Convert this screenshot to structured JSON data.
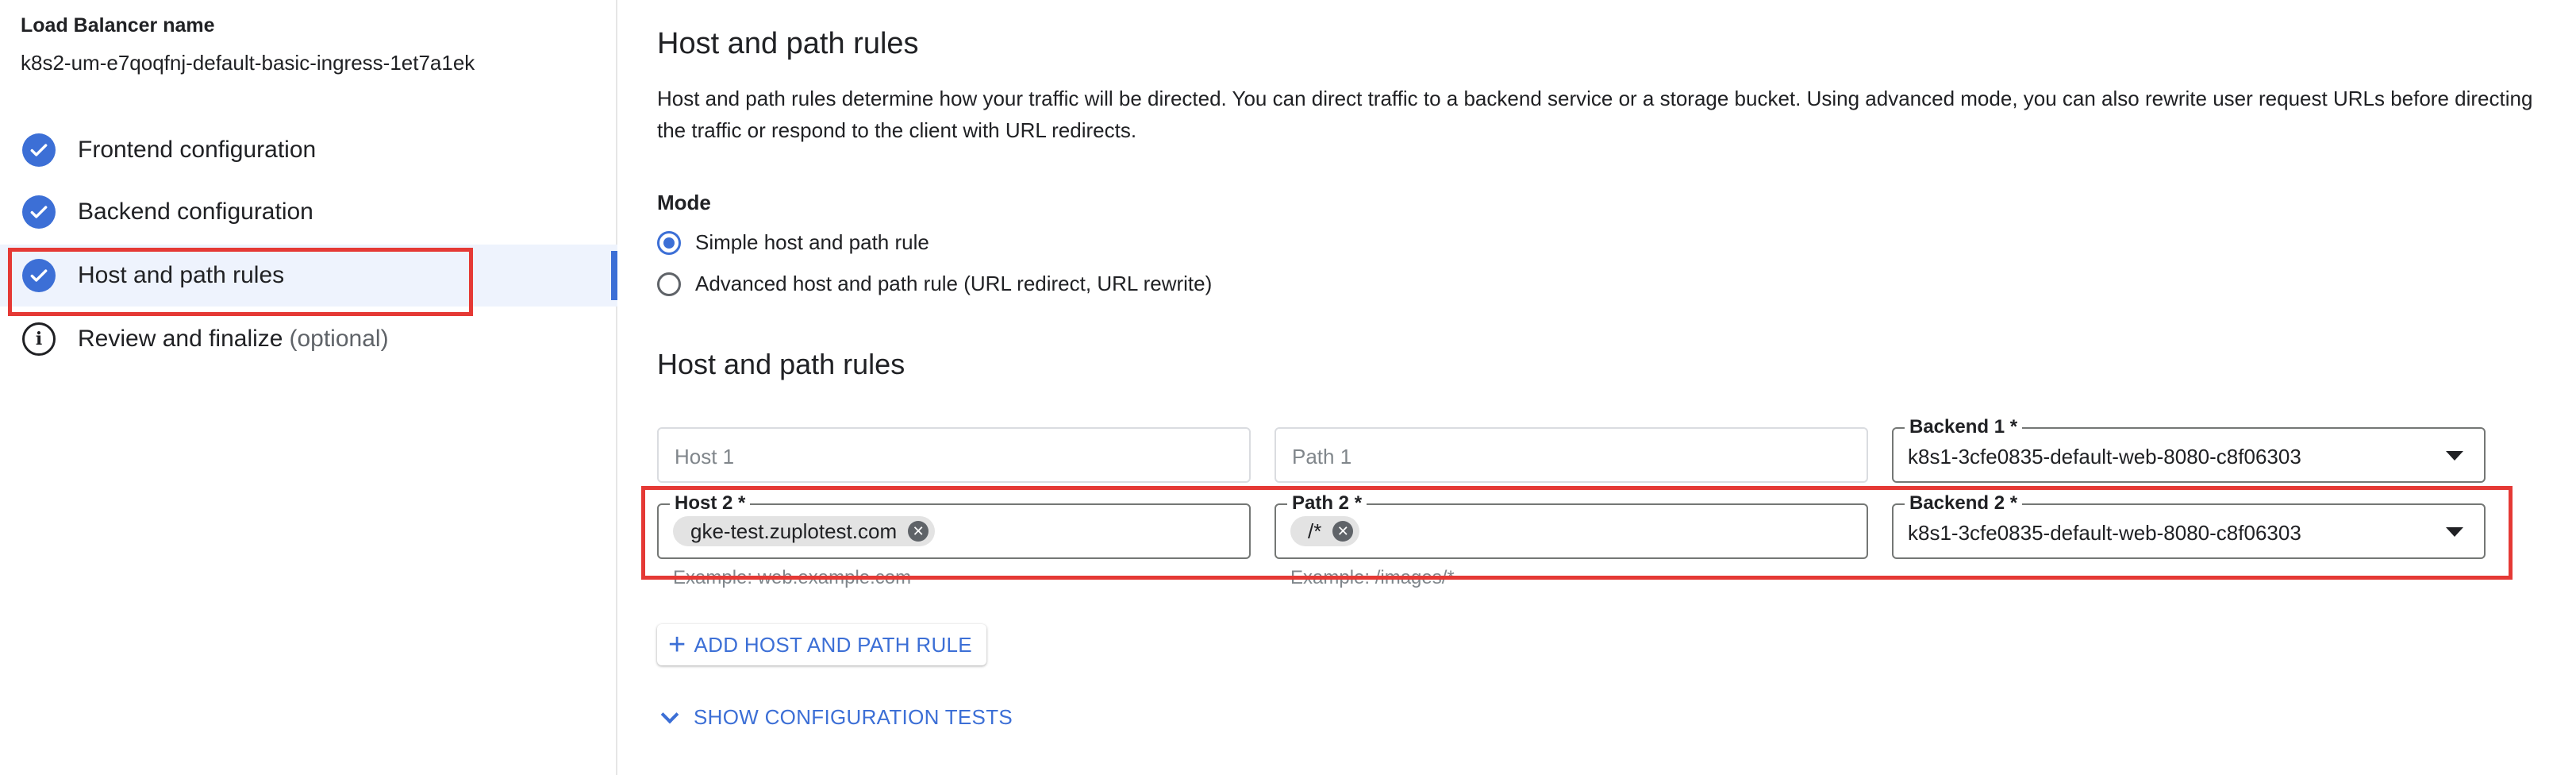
{
  "sidebar": {
    "lb_name_label": "Load Balancer name",
    "lb_name_value": "k8s2-um-e7qoqfnj-default-basic-ingress-1et7a1ek",
    "steps": [
      {
        "label": "Frontend configuration",
        "status": "done"
      },
      {
        "label": "Backend configuration",
        "status": "done"
      },
      {
        "label": "Host and path rules",
        "status": "done",
        "active": true
      },
      {
        "label": "Review and finalize",
        "suffix": "(optional)",
        "status": "info"
      }
    ]
  },
  "main": {
    "title": "Host and path rules",
    "description": "Host and path rules determine how your traffic will be directed. You can direct traffic to a backend service or a storage bucket. Using advanced mode, you can also rewrite user request URLs before directing the traffic or respond to the client with URL redirects.",
    "mode_label": "Mode",
    "mode_options": [
      {
        "label": "Simple host and path rule",
        "selected": true
      },
      {
        "label": "Advanced host and path rule (URL redirect, URL rewrite)",
        "selected": false
      }
    ],
    "rules_title": "Host and path rules",
    "rule1": {
      "host_placeholder": "Host 1",
      "path_placeholder": "Path 1",
      "backend_label": "Backend 1 *",
      "backend_value": "k8s1-3cfe0835-default-web-8080-c8f06303"
    },
    "rule2": {
      "host_label": "Host 2 *",
      "host_chip": "gke-test.zuplotest.com",
      "host_hint": "Example: web.example.com",
      "path_label": "Path 2 *",
      "path_chip": "/*",
      "path_hint": "Example: /images/*",
      "backend_label": "Backend 2 *",
      "backend_value": "k8s1-3cfe0835-default-web-8080-c8f06303"
    },
    "add_rule_button": "ADD HOST AND PATH RULE",
    "show_tests_link": "SHOW CONFIGURATION TESTS"
  },
  "colors": {
    "accent": "#3c6fd6",
    "highlight_box": "#e53935",
    "active_step_bg": "#eef3fd"
  }
}
